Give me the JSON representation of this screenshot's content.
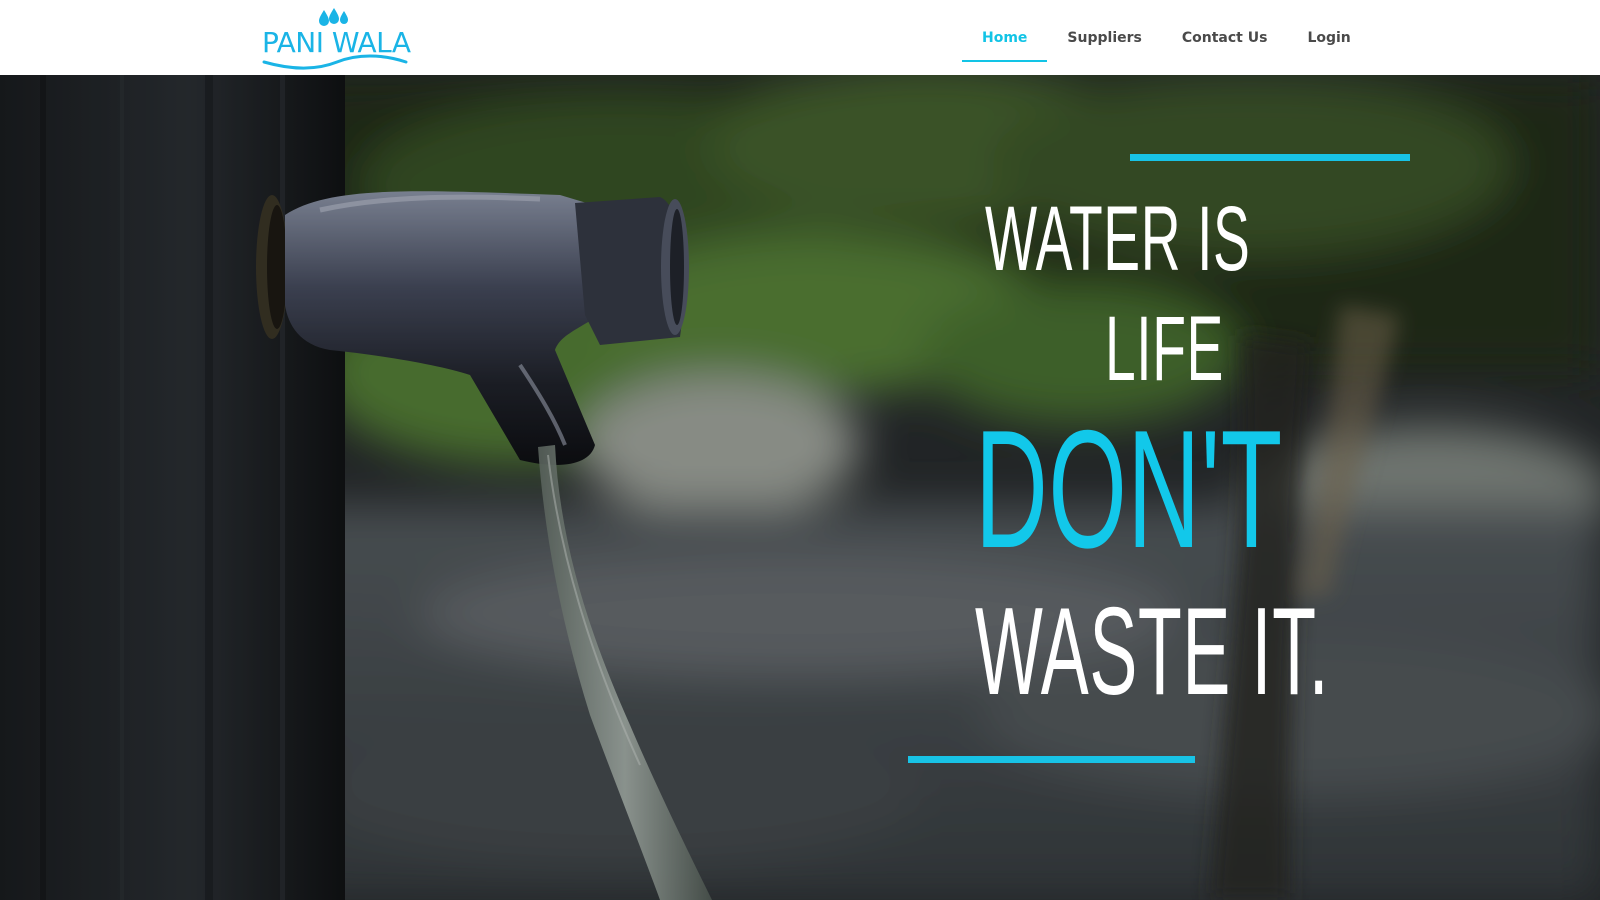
{
  "brand": {
    "logo_text": "PANI WALA",
    "accent_color": "#1ab4e6"
  },
  "nav": {
    "items": [
      {
        "label": "Home",
        "active": true
      },
      {
        "label": "Suppliers",
        "active": false
      },
      {
        "label": "Contact Us",
        "active": false
      },
      {
        "label": "Login",
        "active": false
      }
    ],
    "active_color": "#12c4e6"
  },
  "hero": {
    "line1": "WATER IS",
    "line2": "LIFE",
    "line3": "DON'T",
    "line4": "WASTE IT.",
    "highlight_color": "#12c8ea",
    "text_color": "#ffffff",
    "background_subject": "water tap with flowing water over blurred greenery"
  }
}
